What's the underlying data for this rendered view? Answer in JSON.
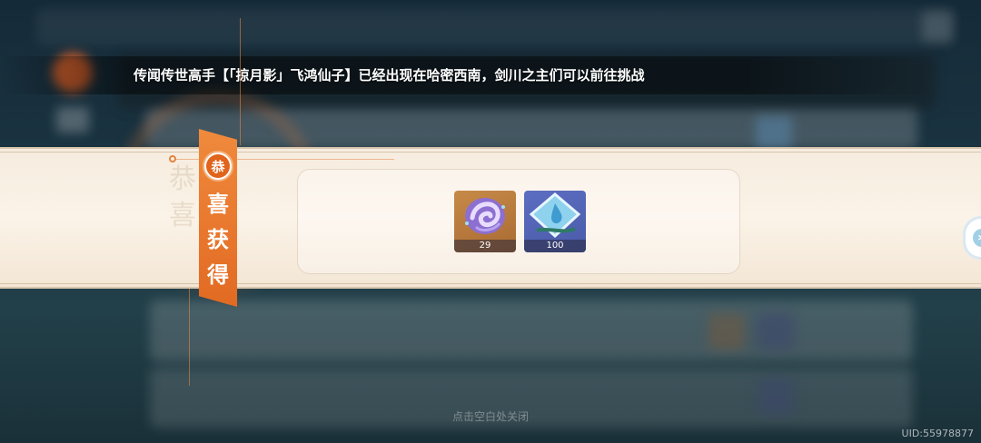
{
  "announcement": {
    "text": "传闻传世高手【「掠月影」飞鸿仙子】已经出现在哈密西南，剑川之主们可以前往挑战"
  },
  "reward_banner": {
    "badge_char": "恭",
    "title_chars": [
      "喜",
      "获",
      "得"
    ],
    "items": [
      {
        "icon": "purple-swirl-material-icon",
        "count": "29",
        "rarity_color": "#c68a48"
      },
      {
        "icon": "blue-water-crystal-icon",
        "count": "100",
        "rarity_color": "#5c6ec2"
      }
    ]
  },
  "close_hint": "点击空白处关闭",
  "uid": "UID:55978877",
  "colors": {
    "ribbon": "#e26a22",
    "banner_bg": "#f6ecdf"
  }
}
